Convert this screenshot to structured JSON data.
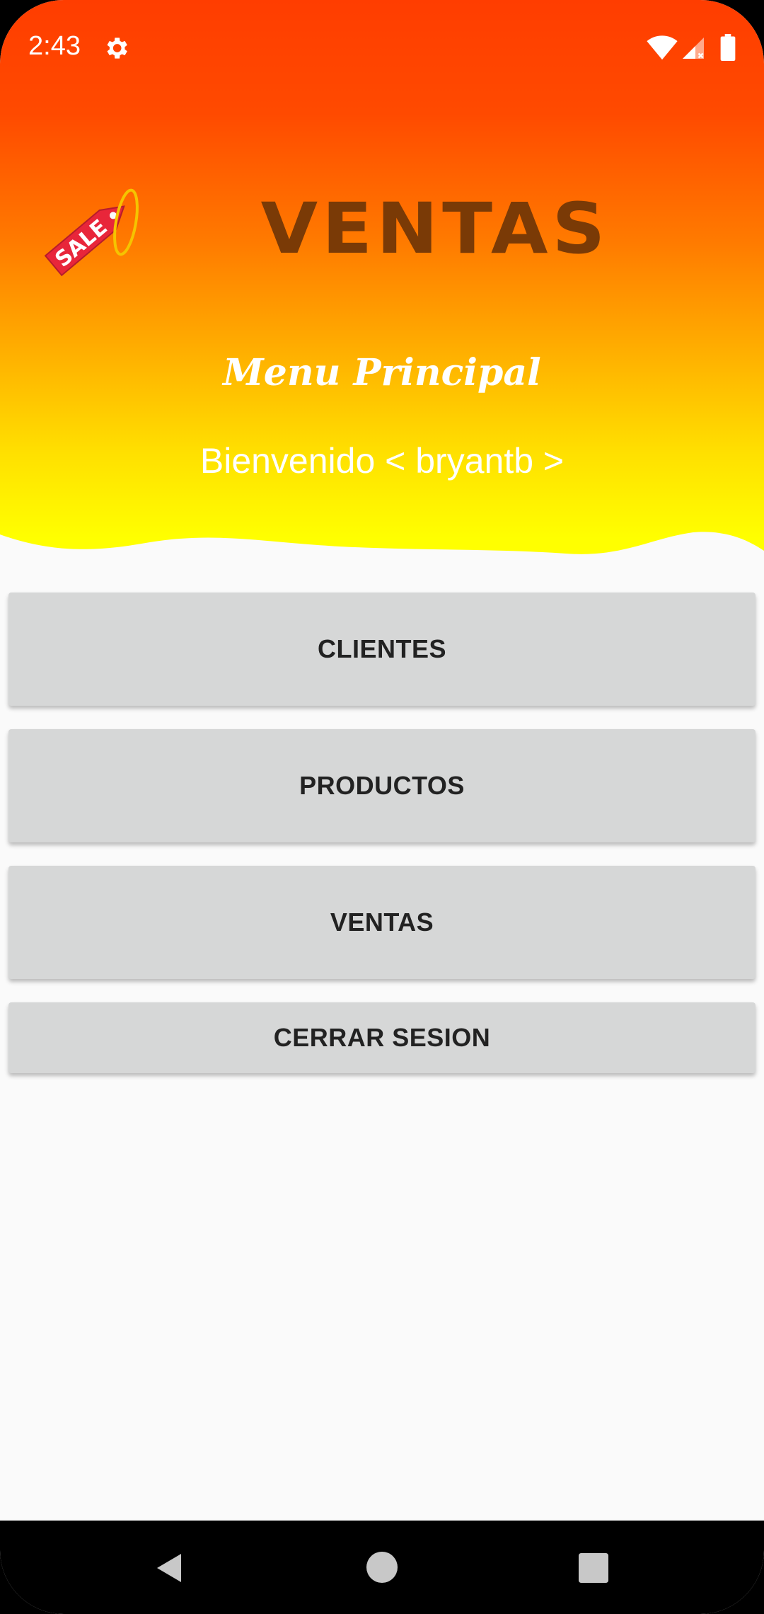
{
  "status_bar": {
    "time": "2:43",
    "icons": [
      "gear-icon",
      "wifi-icon",
      "signal-icon",
      "battery-icon"
    ]
  },
  "header": {
    "logo_text": "SALE",
    "title": "VENTAS",
    "subtitle": "Menu Principal",
    "welcome": "Bienvenido < bryantb >"
  },
  "menu": {
    "clientes": "CLIENTES",
    "productos": "PRODUCTOS",
    "ventas": "VENTAS",
    "cerrar_sesion": "CERRAR SESION"
  },
  "nav_bar": {
    "icons": [
      "back-icon",
      "home-icon",
      "recents-icon"
    ]
  },
  "colors": {
    "gradient_top": "#ff3d00",
    "gradient_bottom": "#ffff00",
    "title_color": "#7a3a06",
    "button_bg": "#d6d7d7",
    "background": "#fafafa"
  }
}
